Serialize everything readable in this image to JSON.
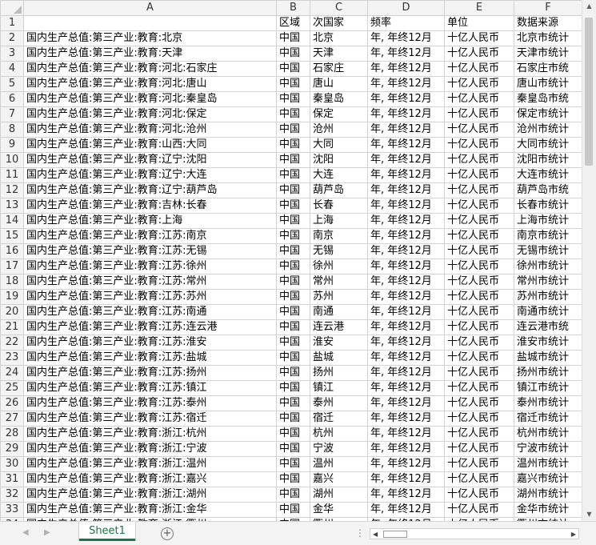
{
  "columns": [
    "A",
    "B",
    "C",
    "D",
    "E",
    "F"
  ],
  "header_row": {
    "num": "1",
    "cells": [
      "",
      "区域",
      "次国家",
      "频率",
      "单位",
      "数据来源"
    ]
  },
  "rows": [
    {
      "num": "2",
      "cells": [
        "国内生产总值:第三产业:教育:北京",
        "中国",
        "北京",
        "年, 年终12月",
        "十亿人民币",
        "北京市统计"
      ]
    },
    {
      "num": "3",
      "cells": [
        "国内生产总值:第三产业:教育:天津",
        "中国",
        "天津",
        "年, 年终12月",
        "十亿人民币",
        "天津市统计"
      ]
    },
    {
      "num": "4",
      "cells": [
        "国内生产总值:第三产业:教育:河北:石家庄",
        "中国",
        "石家庄",
        "年, 年终12月",
        "十亿人民币",
        "石家庄市统"
      ]
    },
    {
      "num": "5",
      "cells": [
        "国内生产总值:第三产业:教育:河北:唐山",
        "中国",
        "唐山",
        "年, 年终12月",
        "十亿人民币",
        "唐山市统计"
      ]
    },
    {
      "num": "6",
      "cells": [
        "国内生产总值:第三产业:教育:河北:秦皇岛",
        "中国",
        "秦皇岛",
        "年, 年终12月",
        "十亿人民币",
        "秦皇岛市统"
      ]
    },
    {
      "num": "7",
      "cells": [
        "国内生产总值:第三产业:教育:河北:保定",
        "中国",
        "保定",
        "年, 年终12月",
        "十亿人民币",
        "保定市统计"
      ]
    },
    {
      "num": "8",
      "cells": [
        "国内生产总值:第三产业:教育:河北:沧州",
        "中国",
        "沧州",
        "年, 年终12月",
        "十亿人民币",
        "沧州市统计"
      ]
    },
    {
      "num": "9",
      "cells": [
        "国内生产总值:第三产业:教育:山西:大同",
        "中国",
        "大同",
        "年, 年终12月",
        "十亿人民币",
        "大同市统计"
      ]
    },
    {
      "num": "10",
      "cells": [
        "国内生产总值:第三产业:教育:辽宁:沈阳",
        "中国",
        "沈阳",
        "年, 年终12月",
        "十亿人民币",
        "沈阳市统计"
      ]
    },
    {
      "num": "11",
      "cells": [
        "国内生产总值:第三产业:教育:辽宁:大连",
        "中国",
        "大连",
        "年, 年终12月",
        "十亿人民币",
        "大连市统计"
      ]
    },
    {
      "num": "12",
      "cells": [
        "国内生产总值:第三产业:教育:辽宁:葫芦岛",
        "中国",
        "葫芦岛",
        "年, 年终12月",
        "十亿人民币",
        "葫芦岛市统"
      ]
    },
    {
      "num": "13",
      "cells": [
        "国内生产总值:第三产业:教育:吉林:长春",
        "中国",
        "长春",
        "年, 年终12月",
        "十亿人民币",
        "长春市统计"
      ]
    },
    {
      "num": "14",
      "cells": [
        "国内生产总值:第三产业:教育:上海",
        "中国",
        "上海",
        "年, 年终12月",
        "十亿人民币",
        "上海市统计"
      ]
    },
    {
      "num": "15",
      "cells": [
        "国内生产总值:第三产业:教育:江苏:南京",
        "中国",
        "南京",
        "年, 年终12月",
        "十亿人民币",
        "南京市统计"
      ]
    },
    {
      "num": "16",
      "cells": [
        "国内生产总值:第三产业:教育:江苏:无锡",
        "中国",
        "无锡",
        "年, 年终12月",
        "十亿人民币",
        "无锡市统计"
      ]
    },
    {
      "num": "17",
      "cells": [
        "国内生产总值:第三产业:教育:江苏:徐州",
        "中国",
        "徐州",
        "年, 年终12月",
        "十亿人民币",
        "徐州市统计"
      ]
    },
    {
      "num": "18",
      "cells": [
        "国内生产总值:第三产业:教育:江苏:常州",
        "中国",
        "常州",
        "年, 年终12月",
        "十亿人民币",
        "常州市统计"
      ]
    },
    {
      "num": "19",
      "cells": [
        "国内生产总值:第三产业:教育:江苏:苏州",
        "中国",
        "苏州",
        "年, 年终12月",
        "十亿人民币",
        "苏州市统计"
      ]
    },
    {
      "num": "20",
      "cells": [
        "国内生产总值:第三产业:教育:江苏:南通",
        "中国",
        "南通",
        "年, 年终12月",
        "十亿人民币",
        "南通市统计"
      ]
    },
    {
      "num": "21",
      "cells": [
        "国内生产总值:第三产业:教育:江苏:连云港",
        "中国",
        "连云港",
        "年, 年终12月",
        "十亿人民币",
        "连云港市统"
      ]
    },
    {
      "num": "22",
      "cells": [
        "国内生产总值:第三产业:教育:江苏:淮安",
        "中国",
        "淮安",
        "年, 年终12月",
        "十亿人民币",
        "淮安市统计"
      ]
    },
    {
      "num": "23",
      "cells": [
        "国内生产总值:第三产业:教育:江苏:盐城",
        "中国",
        "盐城",
        "年, 年终12月",
        "十亿人民币",
        "盐城市统计"
      ]
    },
    {
      "num": "24",
      "cells": [
        "国内生产总值:第三产业:教育:江苏:扬州",
        "中国",
        "扬州",
        "年, 年终12月",
        "十亿人民币",
        "扬州市统计"
      ]
    },
    {
      "num": "25",
      "cells": [
        "国内生产总值:第三产业:教育:江苏:镇江",
        "中国",
        "镇江",
        "年, 年终12月",
        "十亿人民币",
        "镇江市统计"
      ]
    },
    {
      "num": "26",
      "cells": [
        "国内生产总值:第三产业:教育:江苏:泰州",
        "中国",
        "泰州",
        "年, 年终12月",
        "十亿人民币",
        "泰州市统计"
      ]
    },
    {
      "num": "27",
      "cells": [
        "国内生产总值:第三产业:教育:江苏:宿迁",
        "中国",
        "宿迁",
        "年, 年终12月",
        "十亿人民币",
        "宿迁市统计"
      ]
    },
    {
      "num": "28",
      "cells": [
        "国内生产总值:第三产业:教育:浙江:杭州",
        "中国",
        "杭州",
        "年, 年终12月",
        "十亿人民币",
        "杭州市统计"
      ]
    },
    {
      "num": "29",
      "cells": [
        "国内生产总值:第三产业:教育:浙江:宁波",
        "中国",
        "宁波",
        "年, 年终12月",
        "十亿人民币",
        "宁波市统计"
      ]
    },
    {
      "num": "30",
      "cells": [
        "国内生产总值:第三产业:教育:浙江:温州",
        "中国",
        "温州",
        "年, 年终12月",
        "十亿人民币",
        "温州市统计"
      ]
    },
    {
      "num": "31",
      "cells": [
        "国内生产总值:第三产业:教育:浙江:嘉兴",
        "中国",
        "嘉兴",
        "年, 年终12月",
        "十亿人民币",
        "嘉兴市统计"
      ]
    },
    {
      "num": "32",
      "cells": [
        "国内生产总值:第三产业:教育:浙江:湖州",
        "中国",
        "湖州",
        "年, 年终12月",
        "十亿人民币",
        "湖州市统计"
      ]
    },
    {
      "num": "33",
      "cells": [
        "国内生产总值:第三产业:教育:浙江:金华",
        "中国",
        "金华",
        "年, 年终12月",
        "十亿人民币",
        "金华市统计"
      ]
    },
    {
      "num": "34",
      "cells": [
        "国内生产总值:第三产业:教育:浙江:衢州",
        "中国",
        "衢州",
        "年, 年终12月",
        "十亿人民币",
        "衢州市统计"
      ]
    }
  ],
  "sheet_tab": {
    "label": "Sheet1",
    "accent": "#217346"
  },
  "controls": {
    "add_sheet": "+",
    "more": "⋮"
  },
  "icons": {
    "nav_prev": "◀",
    "nav_next": "▶",
    "scroll_up": "▲",
    "scroll_down": "▼",
    "scroll_left": "◀",
    "scroll_right": "▶"
  }
}
